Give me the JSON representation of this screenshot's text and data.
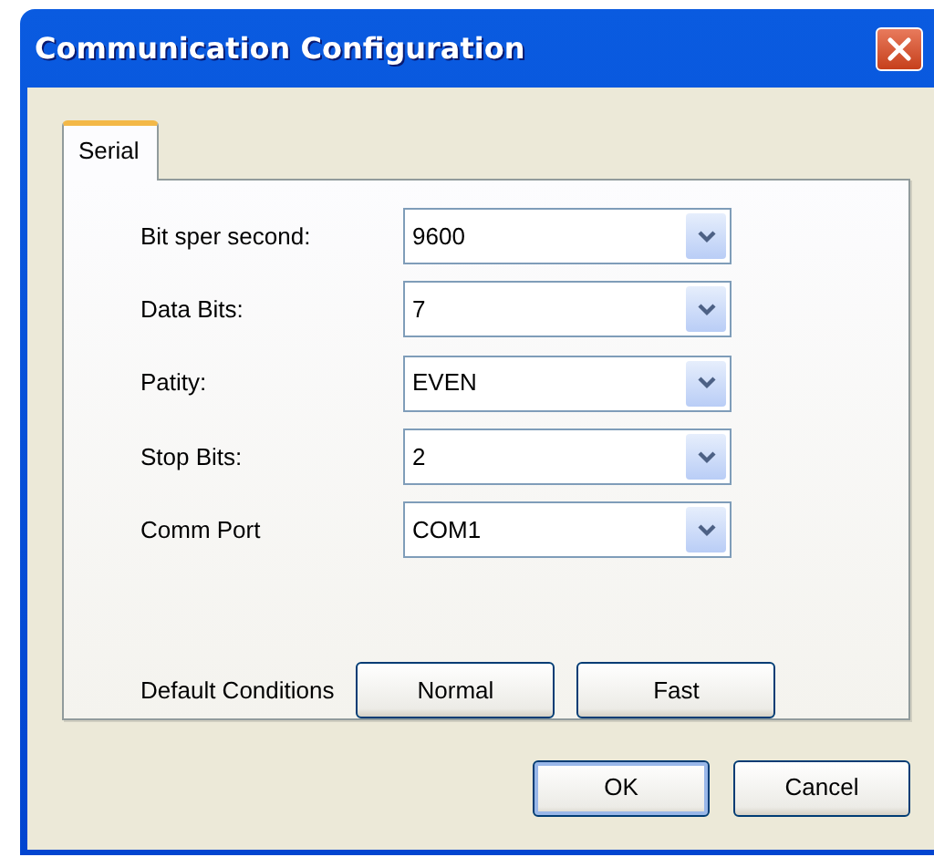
{
  "window": {
    "title": "Communication Configuration"
  },
  "tabs": [
    {
      "label": "Serial",
      "selected": true
    }
  ],
  "fields": [
    {
      "label": "Bit sper second:",
      "value": "9600"
    },
    {
      "label": "Data Bits:",
      "value": "7"
    },
    {
      "label": "Patity:",
      "value": "EVEN"
    },
    {
      "label": "Stop Bits:",
      "value": "2"
    },
    {
      "label": "Comm Port",
      "value": "COM1"
    }
  ],
  "default_conditions": {
    "label": "Default Conditions",
    "buttons": [
      "Normal",
      "Fast"
    ]
  },
  "buttons": [
    {
      "label": "OK",
      "default": true
    },
    {
      "label": "Cancel",
      "default": false
    }
  ]
}
